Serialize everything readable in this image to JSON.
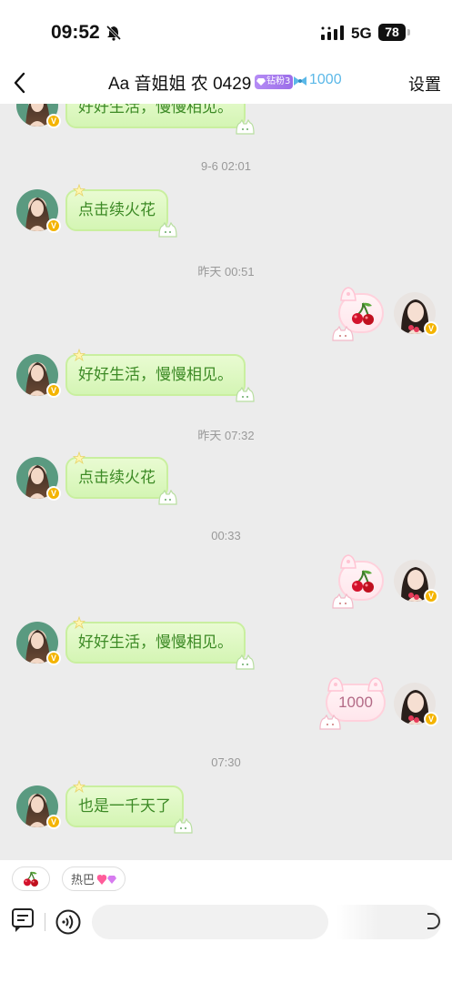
{
  "status_bar": {
    "time": "09:52",
    "network": "5G",
    "battery": "78"
  },
  "nav": {
    "title": "Aa 音姐姐 农 0429",
    "badge_label": "钻粉3",
    "fan_count": "1000",
    "settings_label": "设置"
  },
  "chat": {
    "top_partial_message": "好好生活，慢慢相见。",
    "timestamps": [
      "9-6 02:01",
      "昨天 00:51",
      "昨天 07:32",
      "00:33",
      "07:30"
    ],
    "messages": [
      {
        "side": "left",
        "text": "点击续火花"
      },
      {
        "side": "right",
        "type": "sticker",
        "icon": "cherry-icon"
      },
      {
        "side": "left",
        "text": "好好生活，慢慢相见。"
      },
      {
        "side": "left",
        "text": "点击续火花"
      },
      {
        "side": "right",
        "type": "sticker",
        "icon": "cherry-icon"
      },
      {
        "side": "left",
        "text": "好好生活，慢慢相见。"
      },
      {
        "side": "right",
        "text": "1000"
      },
      {
        "side": "left",
        "text": "也是一千天了"
      }
    ]
  },
  "quick_replies": [
    {
      "icon": "cherry-icon",
      "label": ""
    },
    {
      "icon": "heart-gem-icon",
      "label": "热巴"
    }
  ],
  "composer": {
    "placeholder": ""
  },
  "colors": {
    "bubble_left_bg": "#d4f5b4",
    "bubble_left_text": "#3c8a25",
    "bubble_right_border": "#ffd1dc",
    "fan_count": "#5bb8e8",
    "badge": "#9b6de8"
  }
}
